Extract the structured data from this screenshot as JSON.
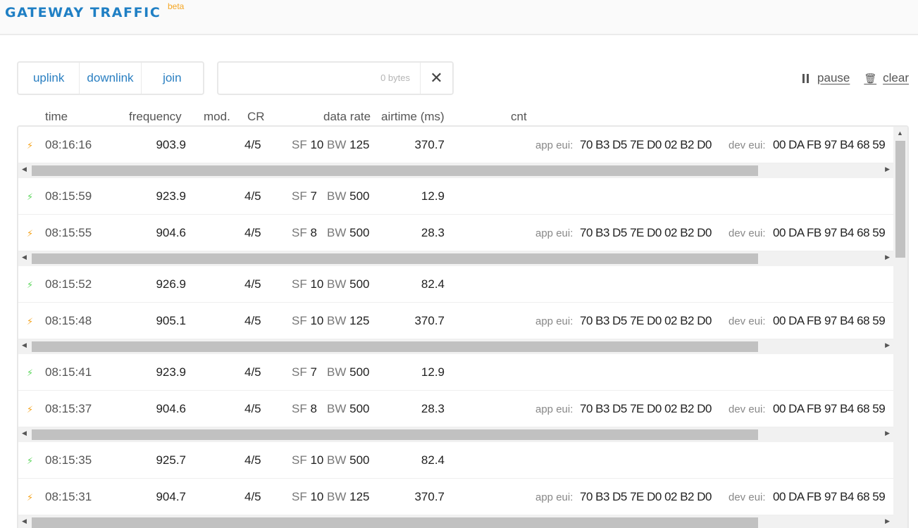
{
  "header": {
    "title": "GATEWAY TRAFFIC",
    "badge": "beta"
  },
  "filters": [
    {
      "label": "uplink"
    },
    {
      "label": "downlink"
    },
    {
      "label": "join"
    }
  ],
  "search": {
    "value": "",
    "placeholder": "",
    "bytes": "0 bytes"
  },
  "controls": {
    "pause": "pause",
    "clear": "clear"
  },
  "columns": {
    "time": "time",
    "frequency": "frequency",
    "mod": "mod.",
    "cr": "CR",
    "data_rate": "data rate",
    "airtime": "airtime (ms)",
    "cnt": "cnt"
  },
  "labels": {
    "sf": "SF",
    "bw": "BW",
    "app_eui": "app eui:",
    "dev_eui": "dev eui:"
  },
  "colors": {
    "accent": "#1f7fc4",
    "uplink": "#f5a623",
    "downlink": "#5cd65c"
  },
  "rows": [
    {
      "direction": "uplink",
      "time": "08:16:16",
      "frequency": "903.9",
      "cr": "4/5",
      "sf": "10",
      "bw": "125",
      "airtime": "370.7",
      "app_eui": "70 B3 D5 7E D0 02 B2 D0",
      "dev_eui": "00 DA FB 97 B4 68 59",
      "has_scroll": true
    },
    {
      "direction": "downlink",
      "time": "08:15:59",
      "frequency": "923.9",
      "cr": "4/5",
      "sf": "7",
      "bw": "500",
      "airtime": "12.9",
      "app_eui": "",
      "dev_eui": "",
      "has_scroll": false
    },
    {
      "direction": "uplink",
      "time": "08:15:55",
      "frequency": "904.6",
      "cr": "4/5",
      "sf": "8",
      "bw": "500",
      "airtime": "28.3",
      "app_eui": "70 B3 D5 7E D0 02 B2 D0",
      "dev_eui": "00 DA FB 97 B4 68 59",
      "has_scroll": true
    },
    {
      "direction": "downlink",
      "time": "08:15:52",
      "frequency": "926.9",
      "cr": "4/5",
      "sf": "10",
      "bw": "500",
      "airtime": "82.4",
      "app_eui": "",
      "dev_eui": "",
      "has_scroll": false
    },
    {
      "direction": "uplink",
      "time": "08:15:48",
      "frequency": "905.1",
      "cr": "4/5",
      "sf": "10",
      "bw": "125",
      "airtime": "370.7",
      "app_eui": "70 B3 D5 7E D0 02 B2 D0",
      "dev_eui": "00 DA FB 97 B4 68 59",
      "has_scroll": true
    },
    {
      "direction": "downlink",
      "time": "08:15:41",
      "frequency": "923.9",
      "cr": "4/5",
      "sf": "7",
      "bw": "500",
      "airtime": "12.9",
      "app_eui": "",
      "dev_eui": "",
      "has_scroll": false
    },
    {
      "direction": "uplink",
      "time": "08:15:37",
      "frequency": "904.6",
      "cr": "4/5",
      "sf": "8",
      "bw": "500",
      "airtime": "28.3",
      "app_eui": "70 B3 D5 7E D0 02 B2 D0",
      "dev_eui": "00 DA FB 97 B4 68 59",
      "has_scroll": true
    },
    {
      "direction": "downlink",
      "time": "08:15:35",
      "frequency": "925.7",
      "cr": "4/5",
      "sf": "10",
      "bw": "500",
      "airtime": "82.4",
      "app_eui": "",
      "dev_eui": "",
      "has_scroll": false
    },
    {
      "direction": "uplink",
      "time": "08:15:31",
      "frequency": "904.7",
      "cr": "4/5",
      "sf": "10",
      "bw": "125",
      "airtime": "370.7",
      "app_eui": "70 B3 D5 7E D0 02 B2 D0",
      "dev_eui": "00 DA FB 97 B4 68 59",
      "has_scroll": true
    }
  ]
}
